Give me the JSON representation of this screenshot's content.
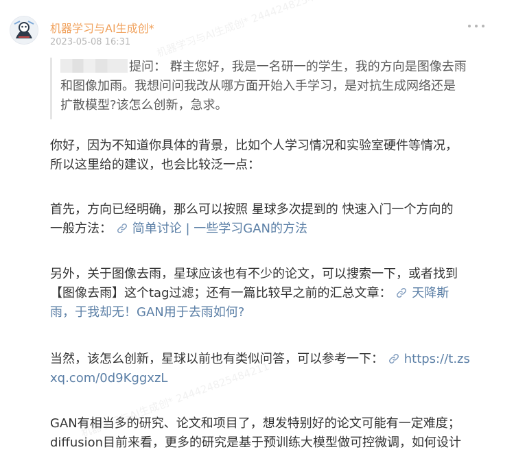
{
  "post": {
    "author": "机器学习与AI生成创*",
    "timestamp": "2023-05-08 16:31",
    "quote": {
      "line1_rest": "提问：  群主您好，我是一名研一的学生，我的方向是图像去雨",
      "line2": "和图像加雨。我想问问我改从哪方面开始入手学习，是对抗生成网络还是",
      "line3": "扩散模型?该怎么创新，急求。"
    },
    "body": {
      "p1": {
        "l1": "你好，因为不知道你具体的背景，比如个人学习情况和实验室硬件等情况，",
        "l2": "所以这里给的建议，也会比较泛一点："
      },
      "p2": {
        "l1": "首先，方向已经明确，那么可以按照 星球多次提到的 快速入门一个方向的",
        "l2_prefix": "一般方法：",
        "l2_link": "简单讨论 | 一些学习GAN的方法"
      },
      "p3": {
        "l1": "另外，关于图像去雨，星球应该也有不少的论文，可以搜索一下，或者找到",
        "l2_prefix": "【图像去雨】这个tag过滤；还有一篇比较早之前的汇总文章：",
        "l2_link": "天降斯",
        "l3_link": "雨，于我却无！GAN用于去雨如何?"
      },
      "p4": {
        "l1_prefix": "当然，该怎么创新，星球以前也有类似问答，可以参考一下：",
        "l1_link": "https://t.zs",
        "l2_link": "xq.com/0d9KggxzL"
      },
      "p5": {
        "l1": "GAN有相当多的研究、论文和项目了，想发特别好的论文可能有一定难度；",
        "l2": "diffusion目前来看，更多的研究是基于预训练大模型做可控微调，如何设计"
      }
    }
  },
  "watermark": {
    "text1": "机器学习与AI生成创* 244424825484211",
    "text2": "机器学习与AI生成创* 244424825484211"
  },
  "colors": {
    "author": "#f0a05a",
    "link": "#5b7fa6",
    "body_text": "#333333",
    "quote_text": "#5b5b5b",
    "timestamp": "#b6b6b6"
  },
  "icons": {
    "link": "chain-link-icon",
    "more": "more-dots-icon"
  }
}
